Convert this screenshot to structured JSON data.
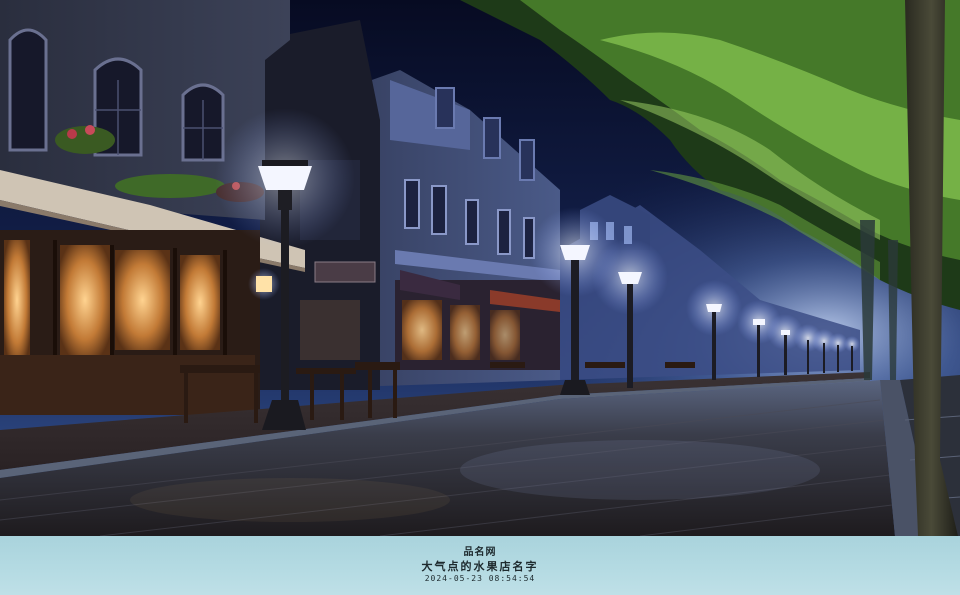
{
  "image": {
    "subject": "night-street",
    "palette": {
      "sky": "#0b1230",
      "lamp_glow": "#e8f0ff",
      "warm_window": "#f1b25c",
      "foliage": "#79b54a",
      "road": "#2a2b33",
      "strip": "#b5dbe3"
    }
  },
  "caption": {
    "brand": "品名网",
    "title": "大气点的水果店名字",
    "timestamp": "2024-05-23 08:54:54"
  }
}
